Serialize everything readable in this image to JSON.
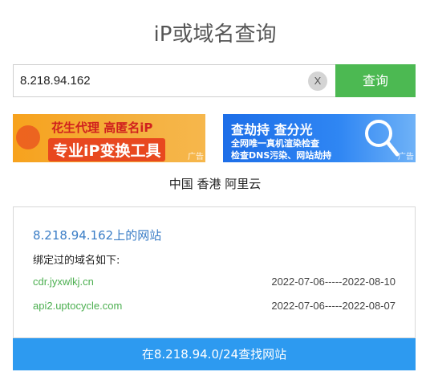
{
  "page": {
    "title": "iP或域名查询"
  },
  "search": {
    "value": "8.218.94.162",
    "clear_label": "X",
    "button_label": "查询"
  },
  "ads": {
    "left": {
      "line1": "花生代理 高匿名iP",
      "line2": "专业iP变换工具",
      "tag": "广告"
    },
    "right": {
      "line1": "查劫持 查分光",
      "line2": "全网唯一真机渲染检查",
      "line3": "检查DNS污染、网站劫持",
      "tag": "广告"
    }
  },
  "location": "中国 香港 阿里云",
  "result": {
    "title": "8.218.94.162上的网站",
    "subtitle": "绑定过的域名如下:",
    "rows": [
      {
        "domain": "cdr.jyxwlkj.cn",
        "date": "2022-07-06-----2022-08-10"
      },
      {
        "domain": "api2.uptocycle.com",
        "date": "2022-07-06-----2022-08-07"
      }
    ]
  },
  "bottom_button": "在8.218.94.0/24查找网站",
  "colors": {
    "search_button": "#4cb952",
    "bottom_button": "#2d9af0",
    "domain_link": "#4caf50",
    "title_link": "#3a7dc6"
  }
}
